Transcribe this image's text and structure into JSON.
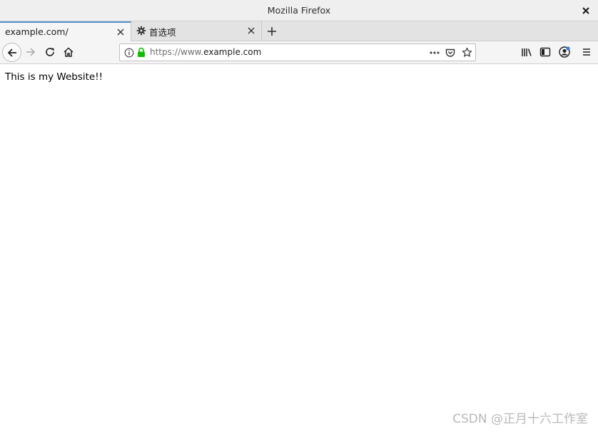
{
  "window": {
    "title": "Mozilla Firefox"
  },
  "tabs": [
    {
      "label": "example.com/",
      "active": true
    },
    {
      "label": "首选项",
      "active": false,
      "icon": "gear-icon"
    }
  ],
  "urlbar": {
    "scheme_prefix": "https://www.",
    "host": "example.com"
  },
  "content": {
    "text": "This is my Website!!"
  },
  "watermark": {
    "text": "CSDN @正月十六工作室"
  },
  "colors": {
    "active_tab_accent": "#5a8fd0",
    "lock_green": "#12bc00",
    "disabled_icon": "#a8a8a8"
  }
}
